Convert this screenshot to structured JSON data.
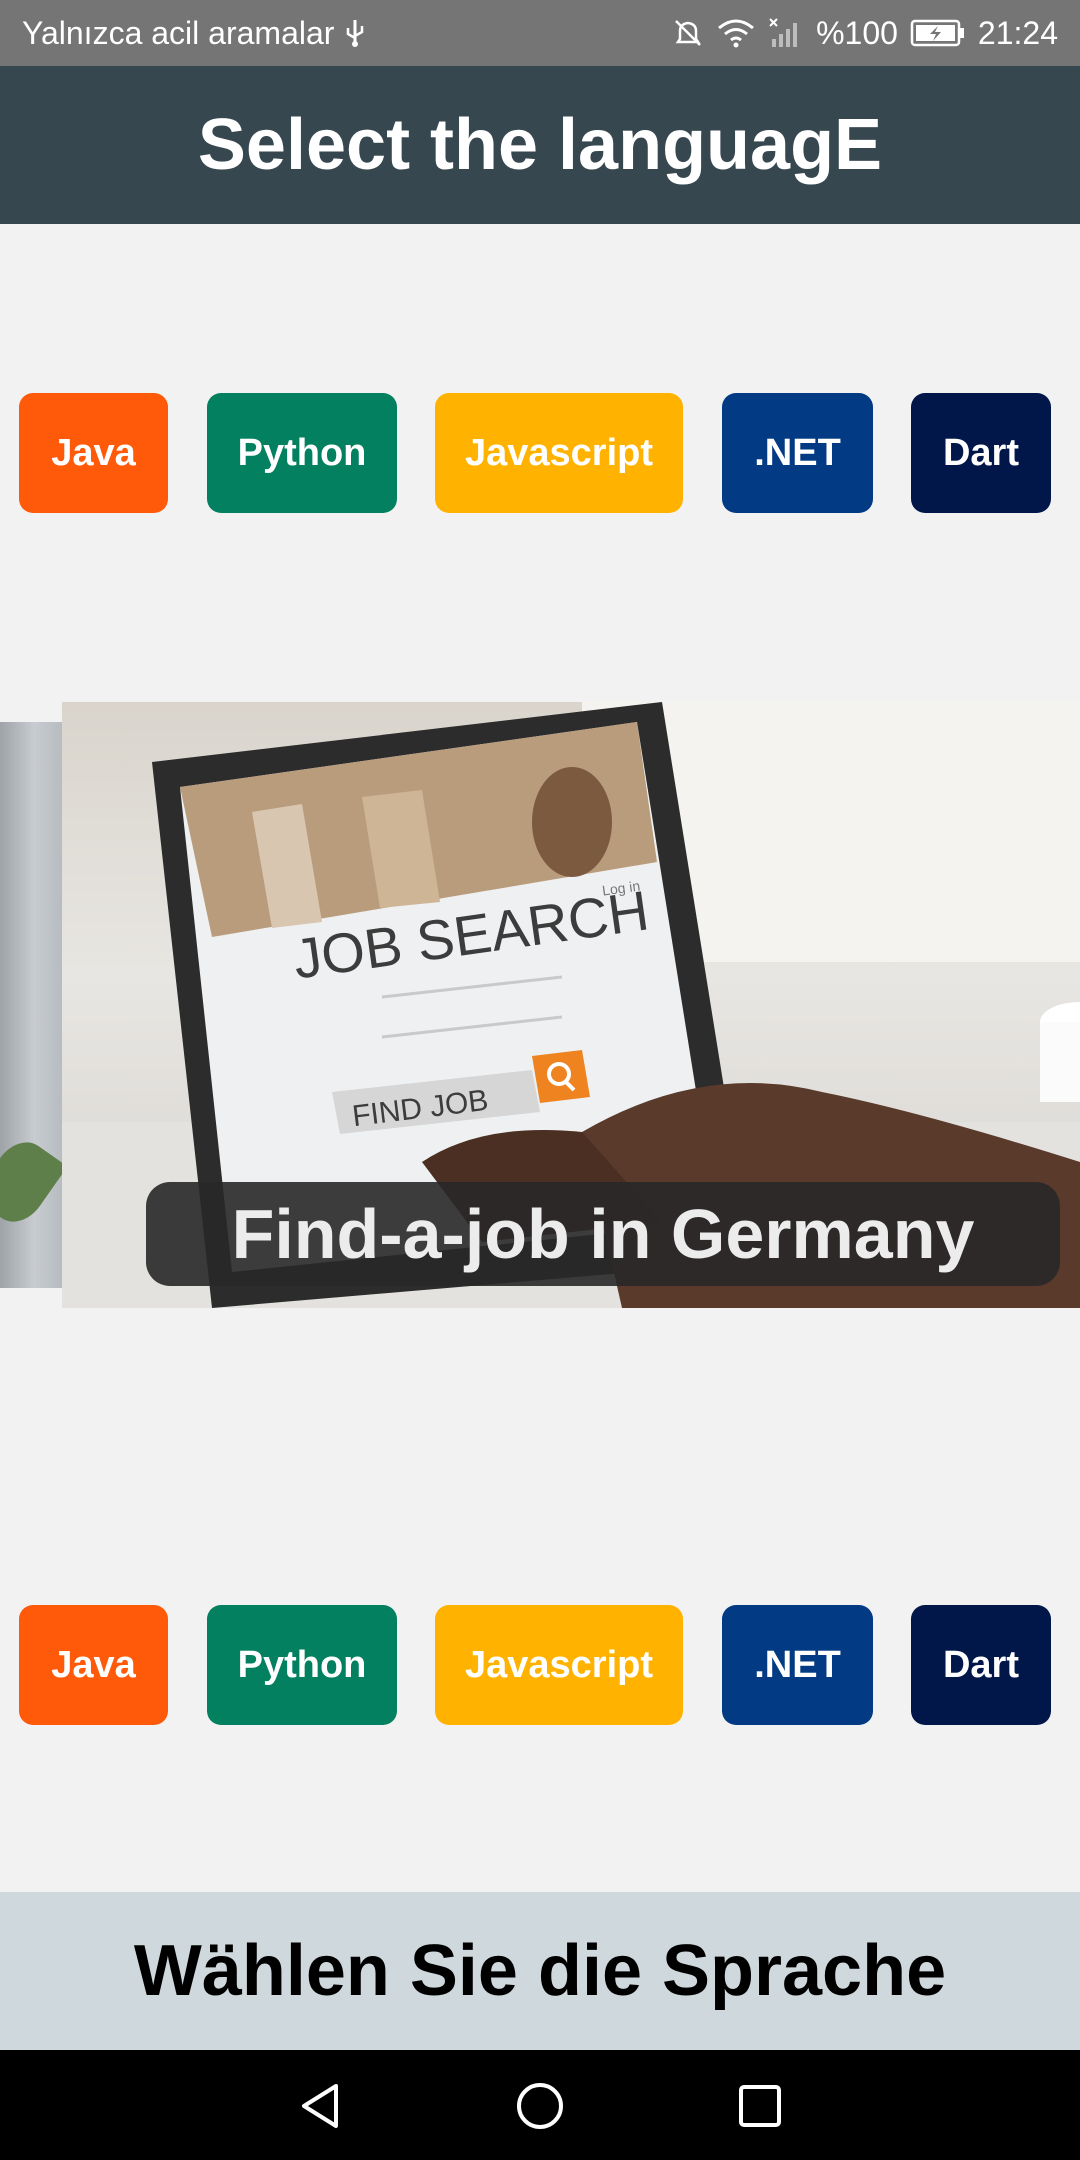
{
  "status_bar": {
    "carrier_text": "Yalnızca acil aramalar",
    "battery_text": "%100",
    "time": "21:24",
    "icons": [
      "usb-icon",
      "mute-icon",
      "wifi-icon",
      "no-signal-icon",
      "battery-charging-icon"
    ]
  },
  "app_bar": {
    "title": "Select the languagE"
  },
  "languages_top": [
    {
      "label": "Java",
      "color": "#ff5a0a"
    },
    {
      "label": "Python",
      "color": "#03805f"
    },
    {
      "label": "Javascript",
      "color": "#ffb300"
    },
    {
      "label": ".NET",
      "color": "#023a84"
    },
    {
      "label": "Dart",
      "color": "#01174a"
    }
  ],
  "carousel": {
    "caption": "Find-a-job in Germany",
    "image_texts": {
      "heading": "JOB SEARCH",
      "button": "FIND JOB",
      "login": "Log in"
    }
  },
  "languages_bottom": [
    {
      "label": "Java",
      "color": "#ff5a0a"
    },
    {
      "label": "Python",
      "color": "#03805f"
    },
    {
      "label": "Javascript",
      "color": "#ffb300"
    },
    {
      "label": ".NET",
      "color": "#023a84"
    },
    {
      "label": "Dart",
      "color": "#01174a"
    }
  ],
  "bottom_label": {
    "text": "Wählen Sie die Sprache"
  },
  "nav_bar": {
    "icons": [
      "back-icon",
      "home-icon",
      "recents-icon"
    ]
  }
}
